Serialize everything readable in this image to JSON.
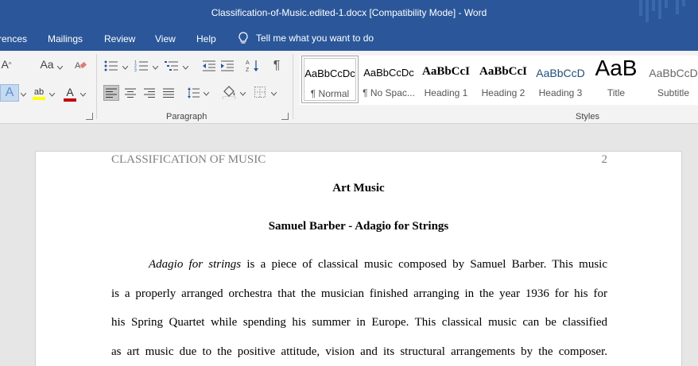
{
  "window": {
    "title": "Classification-of-Music.edited-1.docx [Compatibility Mode]  -  Word"
  },
  "menu": {
    "items": [
      "rences",
      "Mailings",
      "Review",
      "View",
      "Help"
    ],
    "tell_me": "Tell me what you want to do"
  },
  "ribbon": {
    "groups": {
      "paragraph": "Paragraph",
      "styles": "Styles"
    },
    "font": {
      "grow_label": "A",
      "change_case_label": "Aa",
      "text_effects_label": "A",
      "highlight_label": "ab",
      "font_color_label": "A"
    },
    "paragraph": {
      "show_marks_label": "¶"
    },
    "styles": [
      {
        "preview": "AaBbCcDc",
        "name": "¶ Normal"
      },
      {
        "preview": "AaBbCcDc",
        "name": "¶ No Spac..."
      },
      {
        "preview": "AaBbCcI",
        "name": "Heading 1"
      },
      {
        "preview": "AaBbCcI",
        "name": "Heading 2"
      },
      {
        "preview": "AaBbCcD",
        "name": "Heading 3"
      },
      {
        "preview": "AaB",
        "name": "Title"
      },
      {
        "preview": "AaBbCcD",
        "name": "Subtitle"
      }
    ],
    "colors": {
      "highlight": "#ffff00",
      "font_color": "#c00000"
    }
  },
  "document": {
    "header_text": "CLASSIFICATION OF MUSIC",
    "page_number": "2",
    "heading1": "Art Music",
    "heading2": "Samuel Barber - Adagio for Strings",
    "para_italic": "Adagio for strings",
    "lines": [
      " is a piece of classical music composed by Samuel Barber. This music",
      "is a properly arranged orchestra that the musician finished arranging in the year 1936 for his for",
      "his Spring Quartet while spending his summer in Europe. This classical music can be classified",
      "as art music due to the positive attitude, vision and its structural arrangements by the composer."
    ]
  }
}
